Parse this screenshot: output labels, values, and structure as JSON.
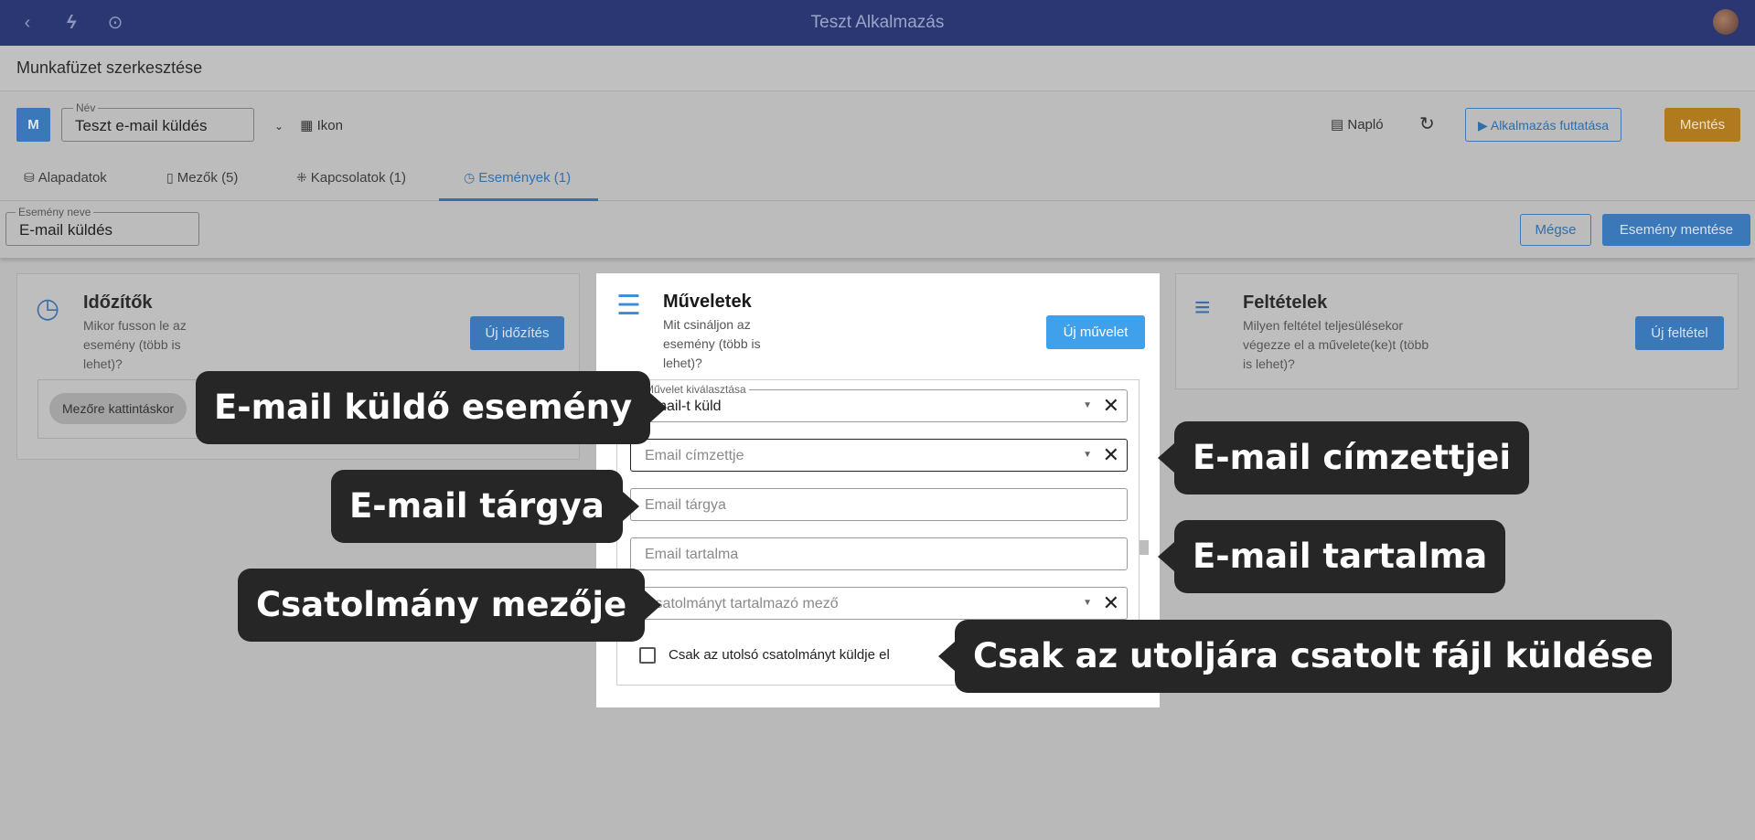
{
  "app": {
    "title": "Teszt Alkalmazás"
  },
  "page": {
    "heading": "Munkafüzet szerkesztése"
  },
  "toolbar": {
    "badge": "M",
    "name_label": "Név",
    "name_value": "Teszt e-mail küldés",
    "icon_label": "Ikon",
    "log_label": "Napló",
    "run_label": "Alkalmazás futtatása",
    "save_label": "Mentés"
  },
  "tabs": [
    {
      "label": "Alapadatok",
      "icon": "database-icon"
    },
    {
      "label": "Mezők (5)",
      "icon": "fields-icon"
    },
    {
      "label": "Kapcsolatok (1)",
      "icon": "relations-icon"
    },
    {
      "label": "Események (1)",
      "icon": "events-icon",
      "active": true
    }
  ],
  "event": {
    "name_label": "Esemény neve",
    "name_value": "E-mail küldés",
    "cancel_label": "Mégse",
    "save_label": "Esemény mentése"
  },
  "timers": {
    "title": "Időzítők",
    "desc": "Mikor fusson le az esemény (több is lehet)?",
    "button": "Új időzítés",
    "chip": "Mezőre kattintáskor"
  },
  "actions": {
    "title": "Műveletek",
    "desc": "Mit csináljon az esemény (több is lehet)?",
    "button": "Új művelet",
    "select_label": "Művelet kiválasztása",
    "select_value": "Email-t küld",
    "recipient_ph": "Email címzettje",
    "subject_ph": "Email tárgya",
    "content_ph": "Email tartalma",
    "attachment_ph": "Csatolmányt tartalmazó mező",
    "last_attachment_label": "Csak az utolsó csatolmányt küldje el"
  },
  "conditions": {
    "title": "Feltételek",
    "desc": "Milyen feltétel teljesülésekor végezze el a művelete(ke)t (több is lehet)?",
    "button": "Új feltétel"
  },
  "callouts": {
    "email_event": "E-mail küldő esemény",
    "recipients": "E-mail címzettjei",
    "subject": "E-mail tárgya",
    "content": "E-mail tartalma",
    "attachment": "Csatolmány mezője",
    "last_file": "Csak az utoljára csatolt fájl küldése"
  },
  "colors": {
    "topbar": "#2a3772",
    "accent": "#3fa0ec",
    "save": "#b07a1f",
    "callout": "#262626"
  }
}
